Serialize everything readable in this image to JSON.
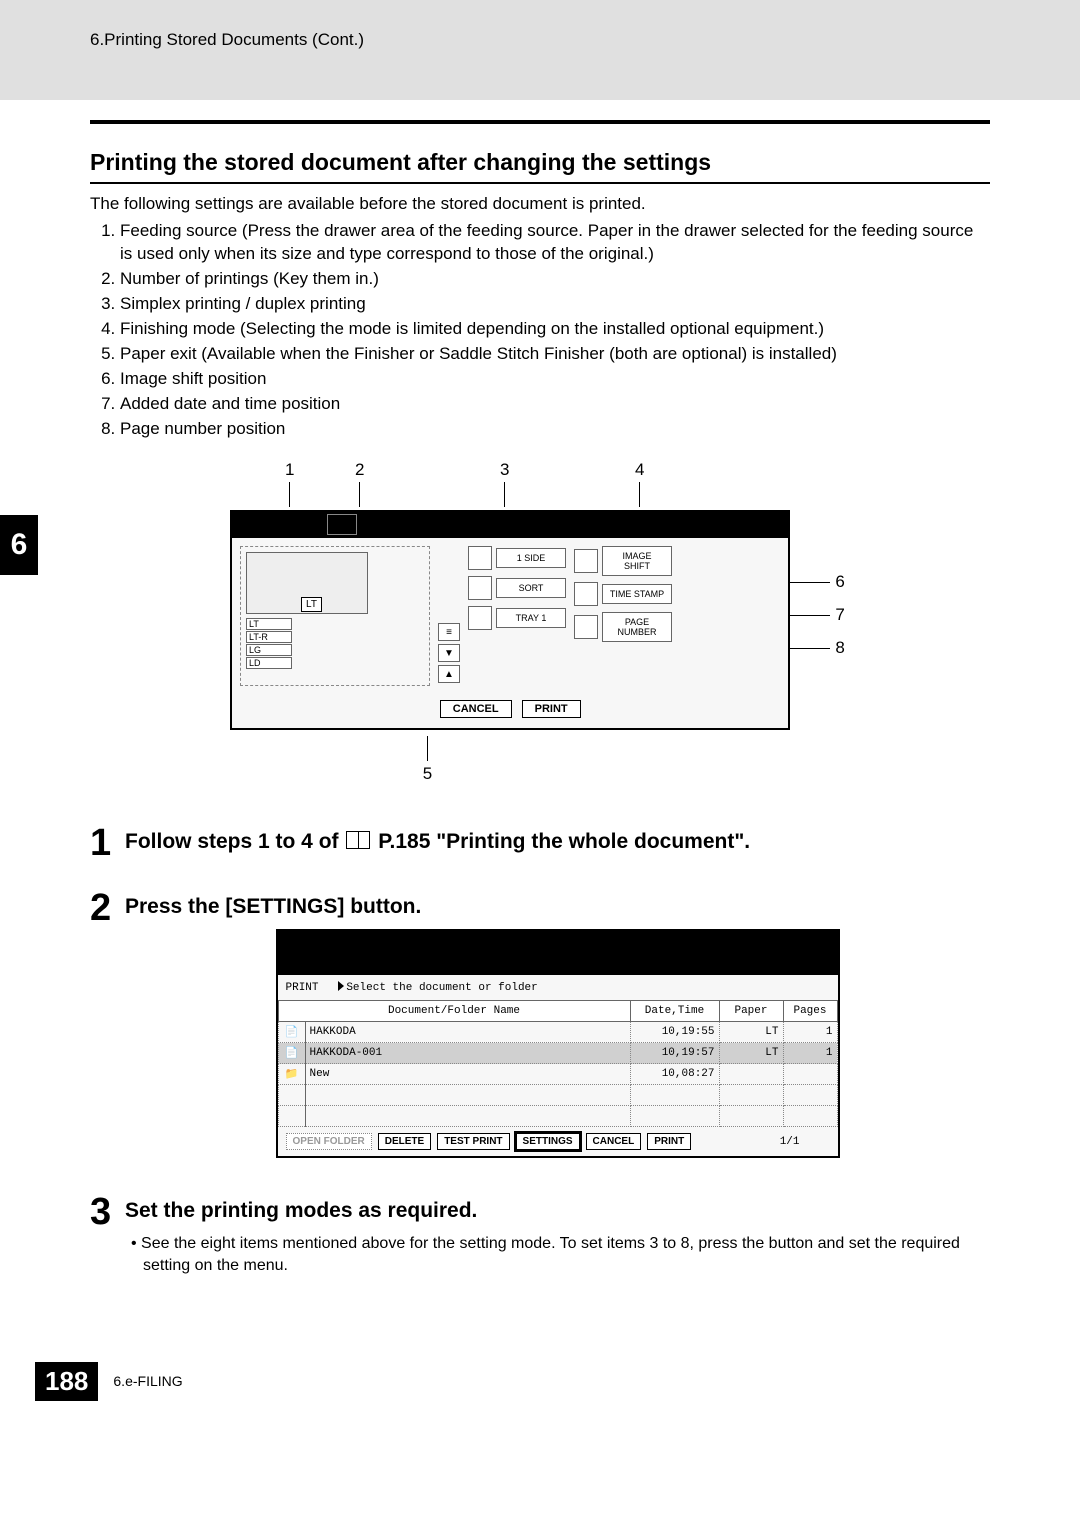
{
  "header": {
    "breadcrumb": "6.Printing Stored Documents (Cont.)"
  },
  "section": {
    "title": "Printing the stored document after changing the settings",
    "intro": "The following settings are available before the stored document is printed.",
    "list": [
      "Feeding source (Press the drawer area of the feeding source. Paper in the drawer selected for the feeding source is used only when its size and type correspond to those of the original.)",
      "Number of printings (Key them in.)",
      "Simplex printing / duplex printing",
      "Finishing mode (Selecting the mode is limited depending on the installed optional equipment.)",
      "Paper exit (Available when the Finisher or Saddle Stitch Finisher (both are optional) is installed)",
      "Image shift position",
      "Added date and time position",
      "Page number position"
    ]
  },
  "side_tab": "6",
  "figure1": {
    "top_callouts": [
      "1",
      "2",
      "3",
      "4"
    ],
    "right_callouts": [
      "6",
      "7",
      "8"
    ],
    "bottom_callout": "5",
    "paper_sizes": [
      "LT",
      "LT-R",
      "LG",
      "LD"
    ],
    "selected_size": "LT",
    "buttons_mid": {
      "r1": "1 SIDE",
      "r2": "SORT",
      "r3": "TRAY 1"
    },
    "buttons_right": {
      "r1": "IMAGE SHIFT",
      "r2": "TIME STAMP",
      "r3": "PAGE NUMBER"
    },
    "cancel": "CANCEL",
    "print": "PRINT"
  },
  "steps": {
    "s1": {
      "num": "1",
      "title_a": "Follow steps 1 to 4 of ",
      "title_b": " P.185 \"Printing the whole document\"."
    },
    "s2": {
      "num": "2",
      "title": "Press the [SETTINGS] button."
    },
    "s3": {
      "num": "3",
      "title": "Set the printing modes as required.",
      "note": "See the eight items mentioned above for the setting mode. To set items 3 to 8, press the button and set the required setting on the menu."
    }
  },
  "panel2": {
    "hdr_left": "PRINT",
    "hdr_right": "Select the document or folder",
    "columns": {
      "c1": "Document/Folder Name",
      "c2": "Date,Time",
      "c3": "Paper",
      "c4": "Pages"
    },
    "rows": [
      {
        "icon": "📄",
        "name": "HAKKODA",
        "dt": "10,19:55",
        "paper": "LT",
        "pages": "1",
        "hl": false
      },
      {
        "icon": "📄",
        "name": "HAKKODA-001",
        "dt": "10,19:57",
        "paper": "LT",
        "pages": "1",
        "hl": true
      },
      {
        "icon": "📁",
        "name": "New",
        "dt": "10,08:27",
        "paper": "",
        "pages": "",
        "hl": false
      }
    ],
    "buttons": {
      "open": "OPEN FOLDER",
      "delete": "DELETE",
      "test": "TEST PRINT",
      "settings": "SETTINGS",
      "cancel": "CANCEL",
      "print": "PRINT"
    },
    "pager": "1/1"
  },
  "footer": {
    "page": "188",
    "text": "6.e-FILING"
  }
}
